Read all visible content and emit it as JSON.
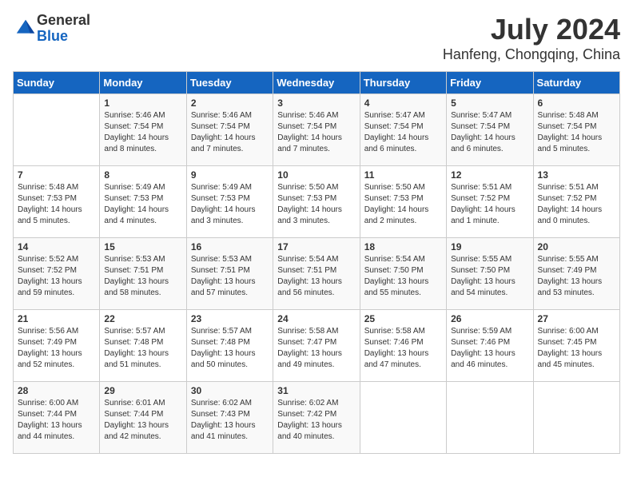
{
  "header": {
    "logo_general": "General",
    "logo_blue": "Blue",
    "month_year": "July 2024",
    "location": "Hanfeng, Chongqing, China"
  },
  "columns": [
    "Sunday",
    "Monday",
    "Tuesday",
    "Wednesday",
    "Thursday",
    "Friday",
    "Saturday"
  ],
  "weeks": [
    [
      {
        "day": "",
        "info": ""
      },
      {
        "day": "1",
        "info": "Sunrise: 5:46 AM\nSunset: 7:54 PM\nDaylight: 14 hours\nand 8 minutes."
      },
      {
        "day": "2",
        "info": "Sunrise: 5:46 AM\nSunset: 7:54 PM\nDaylight: 14 hours\nand 7 minutes."
      },
      {
        "day": "3",
        "info": "Sunrise: 5:46 AM\nSunset: 7:54 PM\nDaylight: 14 hours\nand 7 minutes."
      },
      {
        "day": "4",
        "info": "Sunrise: 5:47 AM\nSunset: 7:54 PM\nDaylight: 14 hours\nand 6 minutes."
      },
      {
        "day": "5",
        "info": "Sunrise: 5:47 AM\nSunset: 7:54 PM\nDaylight: 14 hours\nand 6 minutes."
      },
      {
        "day": "6",
        "info": "Sunrise: 5:48 AM\nSunset: 7:54 PM\nDaylight: 14 hours\nand 5 minutes."
      }
    ],
    [
      {
        "day": "7",
        "info": "Sunrise: 5:48 AM\nSunset: 7:53 PM\nDaylight: 14 hours\nand 5 minutes."
      },
      {
        "day": "8",
        "info": "Sunrise: 5:49 AM\nSunset: 7:53 PM\nDaylight: 14 hours\nand 4 minutes."
      },
      {
        "day": "9",
        "info": "Sunrise: 5:49 AM\nSunset: 7:53 PM\nDaylight: 14 hours\nand 3 minutes."
      },
      {
        "day": "10",
        "info": "Sunrise: 5:50 AM\nSunset: 7:53 PM\nDaylight: 14 hours\nand 3 minutes."
      },
      {
        "day": "11",
        "info": "Sunrise: 5:50 AM\nSunset: 7:53 PM\nDaylight: 14 hours\nand 2 minutes."
      },
      {
        "day": "12",
        "info": "Sunrise: 5:51 AM\nSunset: 7:52 PM\nDaylight: 14 hours\nand 1 minute."
      },
      {
        "day": "13",
        "info": "Sunrise: 5:51 AM\nSunset: 7:52 PM\nDaylight: 14 hours\nand 0 minutes."
      }
    ],
    [
      {
        "day": "14",
        "info": "Sunrise: 5:52 AM\nSunset: 7:52 PM\nDaylight: 13 hours\nand 59 minutes."
      },
      {
        "day": "15",
        "info": "Sunrise: 5:53 AM\nSunset: 7:51 PM\nDaylight: 13 hours\nand 58 minutes."
      },
      {
        "day": "16",
        "info": "Sunrise: 5:53 AM\nSunset: 7:51 PM\nDaylight: 13 hours\nand 57 minutes."
      },
      {
        "day": "17",
        "info": "Sunrise: 5:54 AM\nSunset: 7:51 PM\nDaylight: 13 hours\nand 56 minutes."
      },
      {
        "day": "18",
        "info": "Sunrise: 5:54 AM\nSunset: 7:50 PM\nDaylight: 13 hours\nand 55 minutes."
      },
      {
        "day": "19",
        "info": "Sunrise: 5:55 AM\nSunset: 7:50 PM\nDaylight: 13 hours\nand 54 minutes."
      },
      {
        "day": "20",
        "info": "Sunrise: 5:55 AM\nSunset: 7:49 PM\nDaylight: 13 hours\nand 53 minutes."
      }
    ],
    [
      {
        "day": "21",
        "info": "Sunrise: 5:56 AM\nSunset: 7:49 PM\nDaylight: 13 hours\nand 52 minutes."
      },
      {
        "day": "22",
        "info": "Sunrise: 5:57 AM\nSunset: 7:48 PM\nDaylight: 13 hours\nand 51 minutes."
      },
      {
        "day": "23",
        "info": "Sunrise: 5:57 AM\nSunset: 7:48 PM\nDaylight: 13 hours\nand 50 minutes."
      },
      {
        "day": "24",
        "info": "Sunrise: 5:58 AM\nSunset: 7:47 PM\nDaylight: 13 hours\nand 49 minutes."
      },
      {
        "day": "25",
        "info": "Sunrise: 5:58 AM\nSunset: 7:46 PM\nDaylight: 13 hours\nand 47 minutes."
      },
      {
        "day": "26",
        "info": "Sunrise: 5:59 AM\nSunset: 7:46 PM\nDaylight: 13 hours\nand 46 minutes."
      },
      {
        "day": "27",
        "info": "Sunrise: 6:00 AM\nSunset: 7:45 PM\nDaylight: 13 hours\nand 45 minutes."
      }
    ],
    [
      {
        "day": "28",
        "info": "Sunrise: 6:00 AM\nSunset: 7:44 PM\nDaylight: 13 hours\nand 44 minutes."
      },
      {
        "day": "29",
        "info": "Sunrise: 6:01 AM\nSunset: 7:44 PM\nDaylight: 13 hours\nand 42 minutes."
      },
      {
        "day": "30",
        "info": "Sunrise: 6:02 AM\nSunset: 7:43 PM\nDaylight: 13 hours\nand 41 minutes."
      },
      {
        "day": "31",
        "info": "Sunrise: 6:02 AM\nSunset: 7:42 PM\nDaylight: 13 hours\nand 40 minutes."
      },
      {
        "day": "",
        "info": ""
      },
      {
        "day": "",
        "info": ""
      },
      {
        "day": "",
        "info": ""
      }
    ]
  ]
}
